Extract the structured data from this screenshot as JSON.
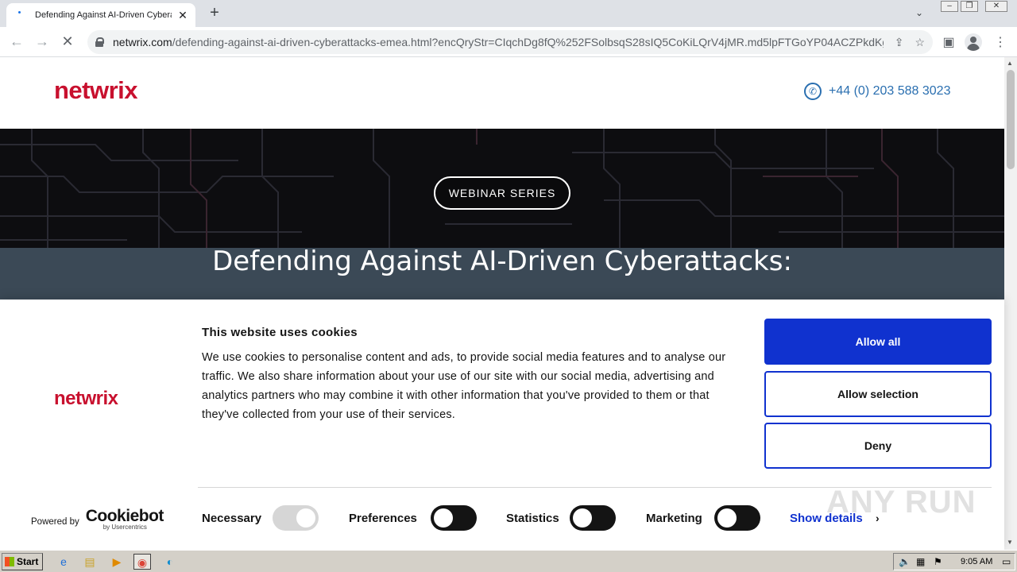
{
  "browser": {
    "tab_title": "Defending Against AI-Driven Cybera",
    "url_domain": "netwrix.com",
    "url_rest": "/defending-against-ai-driven-cyberattacks-emea.html?encQryStr=CIqchDg8fQ%252FSolbsqS28sIQ5CoKiLQrV4jMR.md5lpFTGoYP04ACZPkdKgi..."
  },
  "site": {
    "logo": "netwrix",
    "phone": "+44 (0) 203 588 3023",
    "badge": "WEBINAR SERIES",
    "hero_title": "Defending Against AI-Driven Cyberattacks:"
  },
  "cookie": {
    "logo": "netwrix",
    "title": "This website uses cookies",
    "text": "We use cookies to personalise content and ads, to provide social media features and to analyse our traffic. We also share information about your use of our site with our social media, advertising and analytics partners who may combine it with other information that you've provided to them or that they've collected from your use of their services.",
    "allow_all": "Allow all",
    "allow_selection": "Allow selection",
    "deny": "Deny",
    "powered_by": "Powered by",
    "cookiebot": "Cookiebot",
    "by_usercentrics": "by Usercentrics",
    "necessary": "Necessary",
    "preferences": "Preferences",
    "statistics": "Statistics",
    "marketing": "Marketing",
    "show_details": "Show details"
  },
  "watermark": "ANY RUN",
  "taskbar": {
    "start": "Start",
    "time": "9:05 AM"
  }
}
